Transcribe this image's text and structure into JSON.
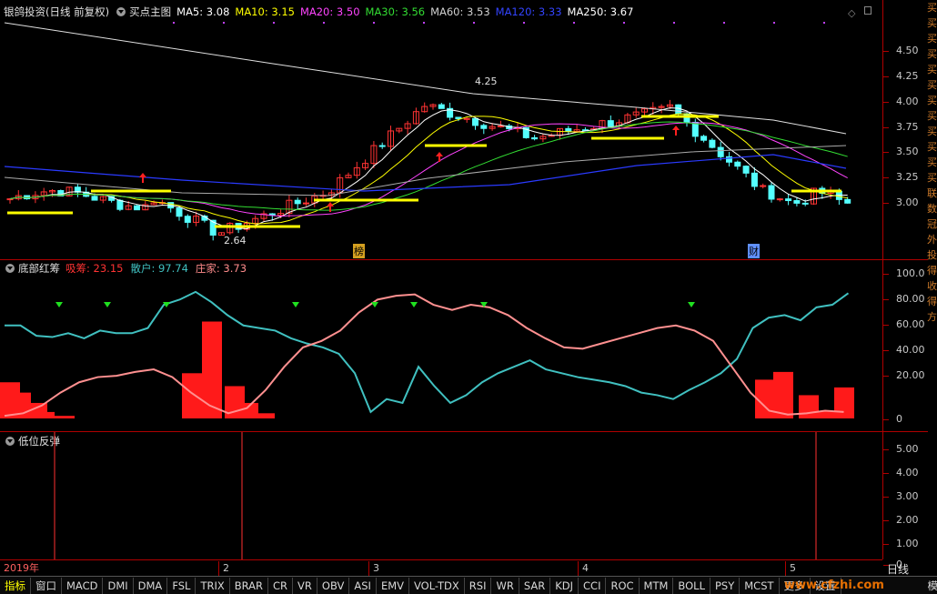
{
  "main": {
    "title": "银鸽投资(日线 前复权)",
    "indicator": "买点主图",
    "ma": [
      {
        "label": "MA5: 3.08",
        "color": "#ffffff"
      },
      {
        "label": "MA10: 3.15",
        "color": "#ffff00"
      },
      {
        "label": "MA20: 3.50",
        "color": "#ff44ff"
      },
      {
        "label": "MA30: 3.56",
        "color": "#33dd33"
      },
      {
        "label": "MA60: 3.53",
        "color": "#d0d0d0"
      },
      {
        "label": "MA120: 3.33",
        "color": "#3344ff"
      },
      {
        "label": "MA250: 3.67",
        "color": "#ffffff"
      }
    ],
    "ticks": [
      "4.50",
      "4.25",
      "4.00",
      "3.75",
      "3.50",
      "3.25",
      "3.00"
    ],
    "high_label": "4.25",
    "low_label": "2.64",
    "marker1": "榜",
    "marker2": "财"
  },
  "pane2": {
    "name": "底部红筹",
    "values": [
      {
        "label": "吸筹: 23.15",
        "color": "#ff3333"
      },
      {
        "label": "散户: 97.74",
        "color": "#40c0c0"
      },
      {
        "label": "庄家: 3.73",
        "color": "#ff8c8c"
      }
    ],
    "ticks": [
      "100.0",
      "80.00",
      "60.00",
      "40.00",
      "20.00",
      "0"
    ]
  },
  "pane3": {
    "name": "低位反弹",
    "ticks": [
      "5.00",
      "4.00",
      "3.00",
      "2.00",
      "1.00",
      "0"
    ]
  },
  "timeaxis": {
    "labels": [
      "2019年",
      "2",
      "3",
      "4",
      "5"
    ],
    "period": "日线"
  },
  "right_strip": [
    "买",
    "买",
    "买",
    "买",
    "买",
    "买",
    "买",
    "买",
    "买",
    "买",
    "买",
    "买",
    "联",
    "数",
    "冠",
    "外",
    "投",
    "得",
    "收",
    "得",
    "方"
  ],
  "tabs": [
    "指标",
    "窗口",
    "MACD",
    "DMI",
    "DMA",
    "FSL",
    "TRIX",
    "BRAR",
    "CR",
    "VR",
    "OBV",
    "ASI",
    "EMV",
    "VOL-TDX",
    "RSI",
    "WR",
    "SAR",
    "KDJ",
    "CCI",
    "ROC",
    "MTM",
    "BOLL",
    "PSY",
    "MCST",
    "更多",
    "设置",
    "模板",
    "+"
  ],
  "watermark": "www.cfzhi.com",
  "colors": {
    "up": "#ff3333",
    "down": "#54ffff",
    "grid": "#b00000",
    "accent": "#ffff00"
  }
}
